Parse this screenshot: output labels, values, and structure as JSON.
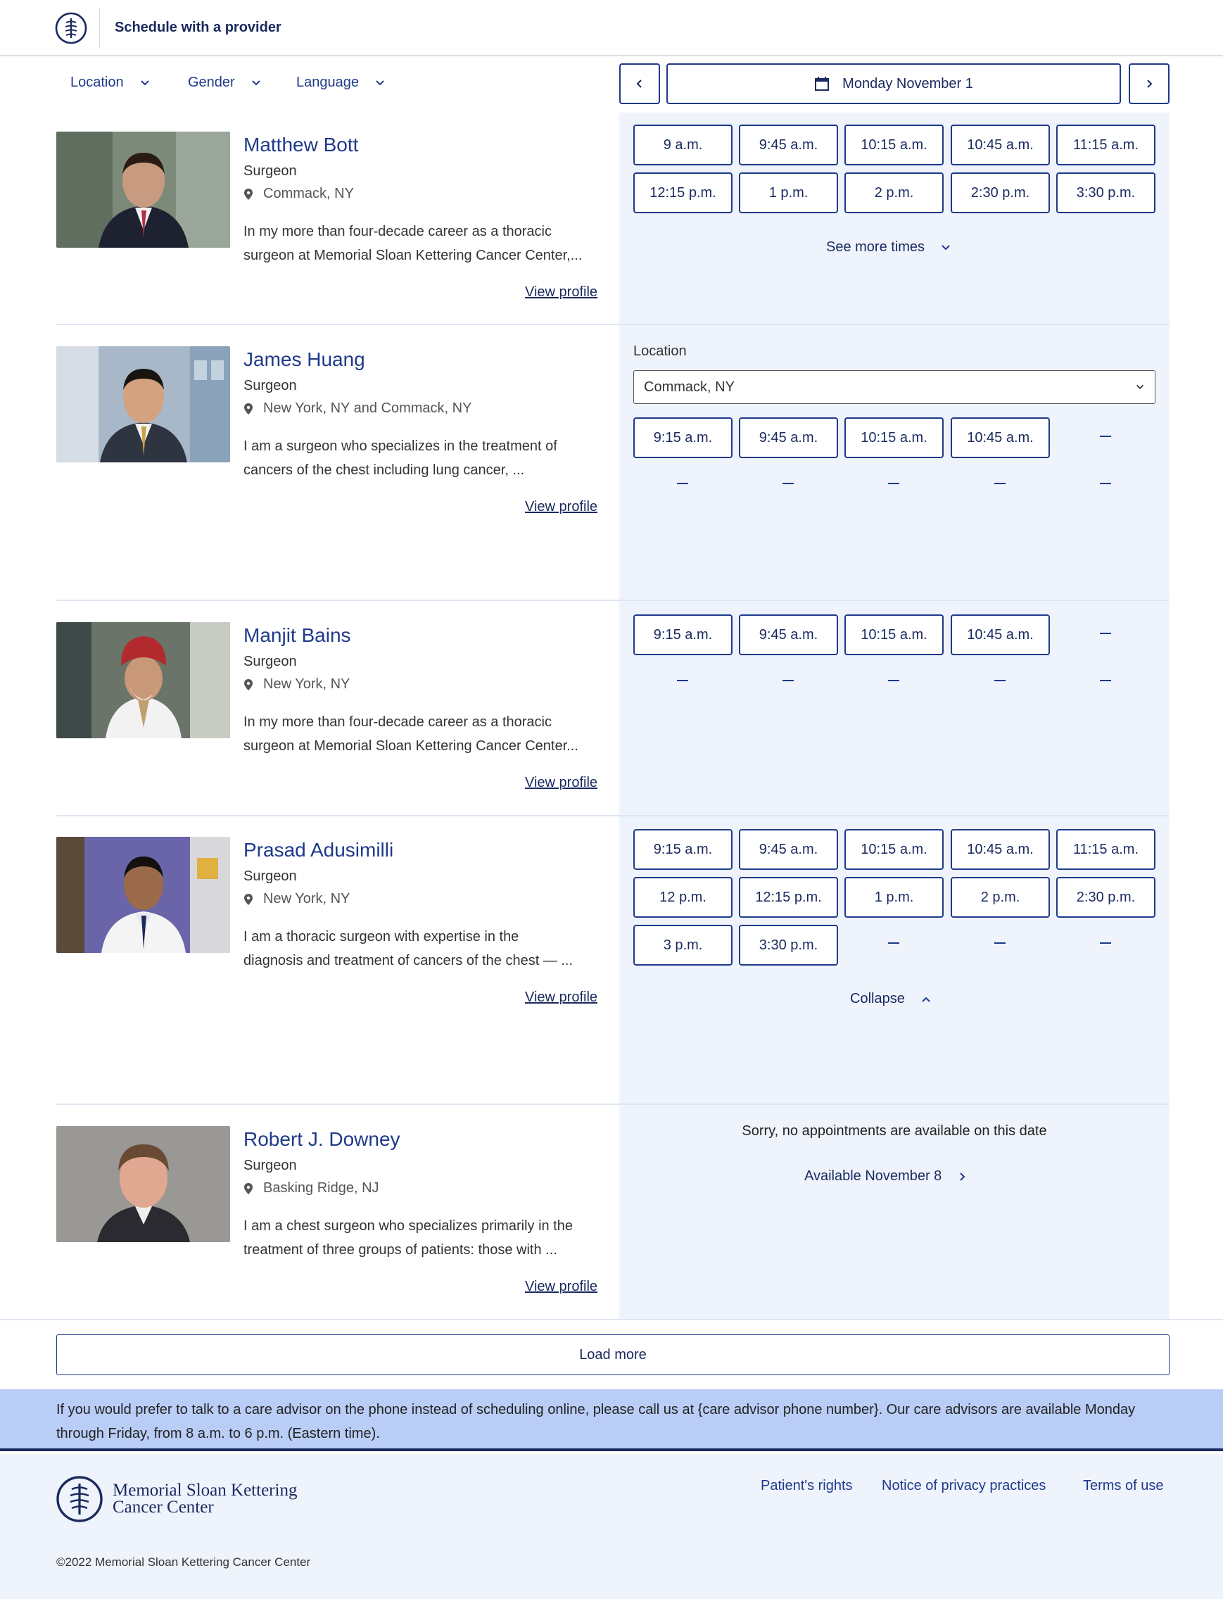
{
  "header": {
    "title": "Schedule with a provider"
  },
  "filters": [
    {
      "label": "Location"
    },
    {
      "label": "Gender"
    },
    {
      "label": "Language"
    }
  ],
  "date_nav": {
    "date": "Monday November 1"
  },
  "providers": [
    {
      "name": "Matthew Bott",
      "role": "Surgeon",
      "location": "Commack, NY",
      "bio_line1": "In my more than four-decade career as a thoracic",
      "bio_line2": "surgeon at Memorial Sloan Kettering Cancer Center,...",
      "link": "View profile",
      "slots": [
        "9 a.m.",
        "9:45 a.m.",
        "10:15 a.m.",
        "10:45 a.m.",
        "11:15 a.m.",
        "12:15 p.m.",
        "1 p.m.",
        "2 p.m.",
        "2:30 p.m.",
        "3:30 p.m."
      ],
      "action": "See more times"
    },
    {
      "name": "James Huang",
      "role": "Surgeon",
      "location": "New York, NY and Commack, NY",
      "bio_line1": "I am a surgeon who specializes in the treatment of",
      "bio_line2": "cancers of the chest including lung cancer, ...",
      "link": "View profile",
      "location_label": "Location",
      "location_value": "Commack, NY",
      "slots": [
        "9:15 a.m.",
        "9:45 a.m.",
        "10:15 a.m.",
        "10:45 a.m."
      ]
    },
    {
      "name": "Manjit Bains",
      "role": "Surgeon",
      "location": "New York, NY",
      "bio_line1": "In my more than four-decade career as a thoracic",
      "bio_line2": "surgeon at Memorial Sloan Kettering Cancer Center...",
      "link": "View profile",
      "slots": [
        "9:15 a.m.",
        "9:45 a.m.",
        "10:15 a.m.",
        "10:45 a.m."
      ]
    },
    {
      "name": "Prasad Adusimilli",
      "role": "Surgeon",
      "location": "New York, NY",
      "bio_line1": "I am a thoracic surgeon with expertise in the",
      "bio_line2": "diagnosis and treatment of cancers of the chest — ...",
      "link": "View profile",
      "slots": [
        "9:15 a.m.",
        "9:45 a.m.",
        "10:15 a.m.",
        "10:45 a.m.",
        "11:15 a.m.",
        "12 p.m.",
        "12:15 p.m.",
        "1 p.m.",
        "2 p.m.",
        "2:30 p.m.",
        "3 p.m.",
        "3:30 p.m."
      ],
      "action": "Collapse"
    },
    {
      "name": "Robert J. Downey",
      "role": "Surgeon",
      "location": "Basking Ridge, NJ",
      "bio_line1": "I am a chest surgeon who specializes primarily in the",
      "bio_line2": "treatment of three groups of patients: those with ...",
      "link": "View profile",
      "no_appointments": "Sorry, no appointments are available on this date",
      "next_available": "Available November 8"
    }
  ],
  "load_more": "Load more",
  "advisor_note": "If you would prefer to talk to a care advisor on the phone instead of scheduling online, please call us at {care advisor phone number}. Our care advisors are available Monday through Friday, from 8 a.m. to 6 p.m. (Eastern time).",
  "footer": {
    "brand_line1": "Memorial Sloan Kettering",
    "brand_line2": "Cancer Center",
    "links": [
      "Patient's rights",
      "Notice of privacy practices",
      "Terms of use"
    ],
    "copyright": "©2022 Memorial Sloan Kettering Cancer Center"
  },
  "colors": {
    "brand": "#1a2a5e",
    "accent": "#1f3a8a",
    "panel": "#eef3fc",
    "advisor": "#b9cdf6"
  }
}
